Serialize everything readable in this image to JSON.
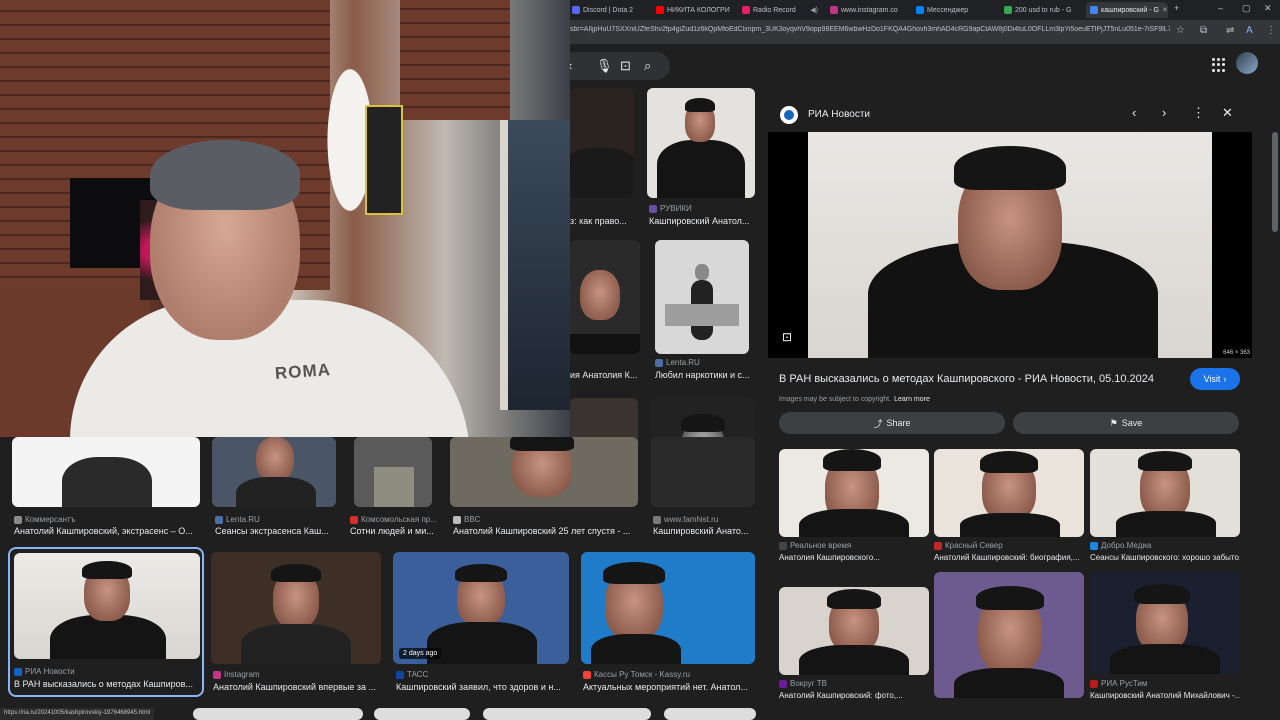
{
  "browser": {
    "tabs": [
      {
        "label": "Discord | Dota 2",
        "color": "#5865f2"
      },
      {
        "label": "НИКИТА КОЛОГРИ",
        "color": "#ff0000"
      },
      {
        "label": "Radio Record",
        "color": "#e91e63"
      },
      {
        "label": "www.instagram.co",
        "color": "#c13584"
      },
      {
        "label": "Мессенджер",
        "color": "#0084ff"
      },
      {
        "label": "200 usd to rub - G",
        "color": "#34a853"
      },
      {
        "label": "кашпировский - G",
        "color": "#4285f4"
      }
    ],
    "new_tab": "+",
    "window_controls": [
      "‒",
      "▢",
      "✕"
    ],
    "address": "sbr=AIljpHuU7SXXniUZfeShv2fp4giZud1z6kQpMfoEdClxnpm_3UK3oyqvhV9opp98EEM6wbwHzDo1FKQA4Ghovh3mhAD4cRG9apCtAW8j0Di4tuL0OFLLm3lpYi5oeuETlPjJT5nLu051e-7iSF9lL7_0w..."
  },
  "search": {
    "icons": [
      "chevron-left-icon",
      "mic-icon",
      "lens-icon",
      "search-icon"
    ]
  },
  "grid": {
    "row1": [
      {
        "caption": "з: как право...",
        "source": ""
      },
      {
        "caption": "Кашпировский Анатол...",
        "source": "РУВИКИ"
      }
    ],
    "row2": [
      {
        "caption": "ия Анатолия К...",
        "source": ""
      },
      {
        "caption": "Любил наркотики и с...",
        "source": "Lenta.RU"
      }
    ],
    "row4": [
      {
        "caption": "Анатолий Кашпировский, экстрасенс – О...",
        "source": "Коммерсантъ",
        "color": "#8a8a8a"
      },
      {
        "caption": "Сеансы экстрасенса Каш...",
        "source": "Lenta.RU",
        "color": "#4a6fa5"
      },
      {
        "caption": "Сотни людей и ми...",
        "source": "Комсомольская пр...",
        "color": "#d32f2f"
      },
      {
        "caption": "Анатолий Кашпировский 25 лет спустя - ...",
        "source": "BBC",
        "color": "#bbbbbb"
      },
      {
        "caption": "Кашпировский Анато...",
        "source": "www.famhist.ru",
        "color": "#7a7a7a"
      }
    ],
    "row5": [
      {
        "caption": "В РАН высказались о методах Кашпиров...",
        "source": "РИА Новости",
        "color": "#1565c0"
      },
      {
        "caption": "Анатолий Кашпировский впервые за ...",
        "source": "Instagram",
        "color": "#c13584"
      },
      {
        "caption": "Кашпировский заявил, что здоров и н...",
        "source": "ТАСС",
        "color": "#0d47a1",
        "badge": "2 days ago"
      },
      {
        "caption": "Актуальных мероприятий нет. Анатол...",
        "source": "Кассы Ру Томск - Kassy.ru",
        "color": "#f44336"
      }
    ]
  },
  "panel": {
    "source": "РИА Новости",
    "dims": "646 × 363",
    "title": "В РАН высказались о методах Кашпировского - РИА Новости, 05.10.2024",
    "visit": "Visit",
    "copyright": "Images may be subject to copyright.",
    "learn_more": "Learn more",
    "share": "Share",
    "save": "Save",
    "related": [
      {
        "source": "Реальное время",
        "caption": "Анатолия Кашпировского...",
        "color": "#444"
      },
      {
        "source": "Красный Север",
        "caption": "Анатолий Кашпировский: биография,...",
        "color": "#c62828"
      },
      {
        "source": "Добро.Медиа",
        "caption": "Сеансы Кашпировского: хорошо забыто...",
        "color": "#1e88e5"
      },
      {
        "source": "Вокруг ТВ",
        "caption": "Анатолий Кашпировский: фото,...",
        "color": "#6a1b9a"
      },
      {
        "source": "",
        "caption": "",
        "color": "#444"
      },
      {
        "source": "РИА РусТим",
        "caption": "Кашпировский Анатолий Михайлович -...",
        "color": "#b71c1c"
      }
    ]
  },
  "webcam": {
    "shirt_text": "ROMA"
  },
  "status_url": "https://ria.ru/20241005/kashpirovskiy-1976468945.html"
}
